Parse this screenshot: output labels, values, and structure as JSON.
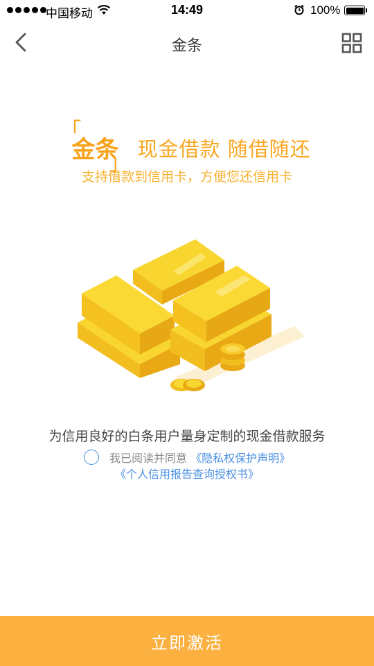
{
  "status_bar": {
    "carrier": "中国移动",
    "time": "14:49",
    "battery": "100%"
  },
  "nav": {
    "title": "金条",
    "back_icon": "chevron-left-icon",
    "menu_icon": "grid-icon"
  },
  "hero": {
    "brand_open": "「",
    "brand": "金条",
    "brand_close": "」",
    "slogan": "现金借款 随借随还",
    "subtitle": "支持借款到信用卡，方便您还信用卡"
  },
  "illustration": {
    "icon": "gold-bars-illustration"
  },
  "description": "为信用良好的白条用户量身定制的现金借款服务",
  "agreement": {
    "prefix": "我已阅读并同意",
    "link1": "《隐私权保护声明》",
    "link2": "《个人信用报告查询授权书》",
    "checked": false
  },
  "action": {
    "label": "立即激活"
  },
  "colors": {
    "brand": "#f7a21b",
    "button": "#fbb040",
    "link": "#4a90e2"
  }
}
